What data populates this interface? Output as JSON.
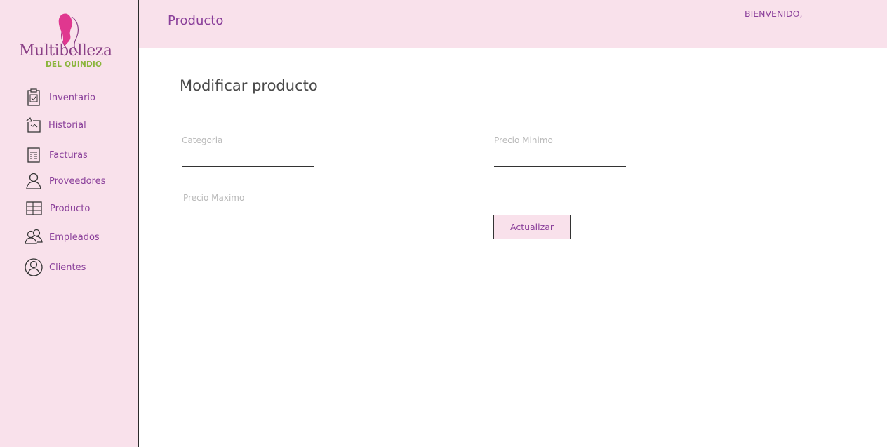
{
  "brand": {
    "name": "Multibelleza",
    "subtitle": "DEL QUINDIO",
    "primary_color": "#8a3f9a",
    "accent_pink": "#e0378f",
    "accent_green": "#8bb53c",
    "sidebar_bg": "#f9e1eb"
  },
  "sidebar": {
    "items": [
      {
        "label": "Inventario",
        "icon": "clipboard-check-icon"
      },
      {
        "label": "Historial",
        "icon": "history-icon"
      },
      {
        "label": "Facturas",
        "icon": "invoice-icon"
      },
      {
        "label": "Proveedores",
        "icon": "person-icon"
      },
      {
        "label": "Producto",
        "icon": "table-icon"
      },
      {
        "label": "Empleados",
        "icon": "group-icon"
      },
      {
        "label": "Clientes",
        "icon": "user-circle-icon"
      }
    ]
  },
  "header": {
    "title": "Producto",
    "welcome": "BIENVENIDO,"
  },
  "main": {
    "title": "Modificar producto",
    "fields": {
      "categoria": {
        "label": "Categoria",
        "value": ""
      },
      "precio_minimo": {
        "label": "Precio Minimo",
        "value": ""
      },
      "precio_maximo": {
        "label": "Precio Maximo",
        "value": ""
      }
    },
    "update_button": "Actualizar"
  }
}
